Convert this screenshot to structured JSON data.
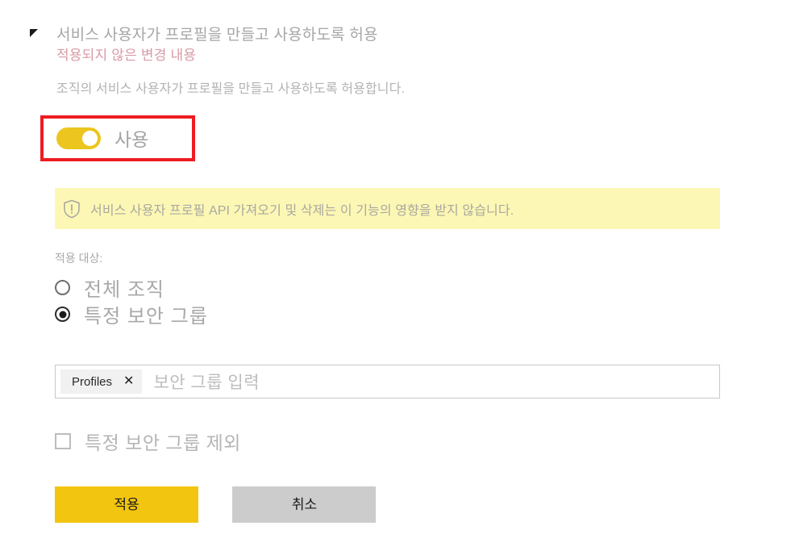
{
  "setting": {
    "title": "서비스 사용자가 프로필을 만들고 사용하도록 허용",
    "unapplied_changes": "적용되지 않은 변경 내용",
    "description": "조직의 서비스 사용자가 프로필을 만들고 사용하도록 허용합니다.",
    "collapse_icon": "triangle-collapse-icon"
  },
  "toggle": {
    "state_label": "사용",
    "state": "on",
    "on_color": "#ecc51e",
    "highlight_color": "#ee1c22"
  },
  "warning": {
    "icon": "shield-exclamation-icon",
    "text": "서비스 사용자 프로필 API 가져오기 및 삭제는 이 기능의 영향을 받지 않습니다.",
    "background_color": "#fdf7b5"
  },
  "applies_to": {
    "label": "적용 대상:",
    "options": [
      {
        "label": "전체 조직",
        "selected": false
      },
      {
        "label": "특정 보안 그룹",
        "selected": true
      }
    ]
  },
  "security_group_input": {
    "chips": [
      {
        "label": "Profiles",
        "remove_icon": "close-icon"
      }
    ],
    "placeholder": "보안 그룹 입력"
  },
  "exclude_checkbox": {
    "label": "특정 보안 그룹 제외",
    "checked": false
  },
  "buttons": {
    "apply": "적용",
    "cancel": "취소",
    "apply_color": "#f2c511",
    "cancel_color": "#cccccc"
  }
}
